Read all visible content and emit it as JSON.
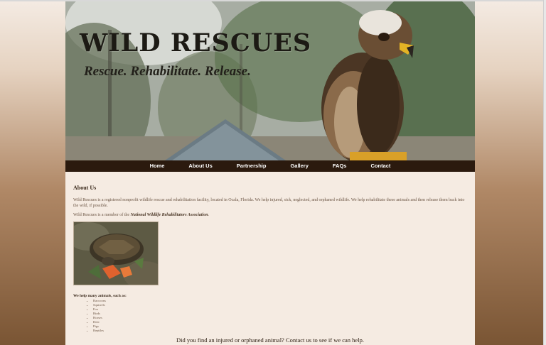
{
  "header": {
    "site_title": "WILD RESCUES",
    "tagline": "Rescue. Rehabilitate. Release."
  },
  "nav": {
    "items": [
      {
        "label": "Home"
      },
      {
        "label": "About Us"
      },
      {
        "label": "Partnership"
      },
      {
        "label": "Gallery"
      },
      {
        "label": "FAQs"
      },
      {
        "label": "Contact"
      }
    ]
  },
  "main": {
    "heading": "About Us",
    "intro": "Wild Rescues is a registered nonprofit wildlife rescue and rehabilitation facility, located in Ocala, Florida. We help injured, sick, neglected, and orphaned wildlife. We help rehabilitate these animals and then release them back into the wild, if possible.",
    "member_prefix": "Wild Rescues is a member of the ",
    "member_org": "National Wildlife Rehabilitators Association",
    "member_suffix": ".",
    "animals_heading": "We help many animals, such as:",
    "animals": [
      "Raccoons",
      "Squirrels",
      "Fox",
      "Birds",
      "Horses",
      "Deer",
      "Pigs",
      "Reptiles"
    ],
    "cta": "Did you find an injured or orphaned animal? Contact us to see if we can help."
  },
  "colors": {
    "nav_bg": "#2b1a0e",
    "page_bg": "#f5ebe2",
    "body_gradient_bottom": "#7a5534"
  }
}
